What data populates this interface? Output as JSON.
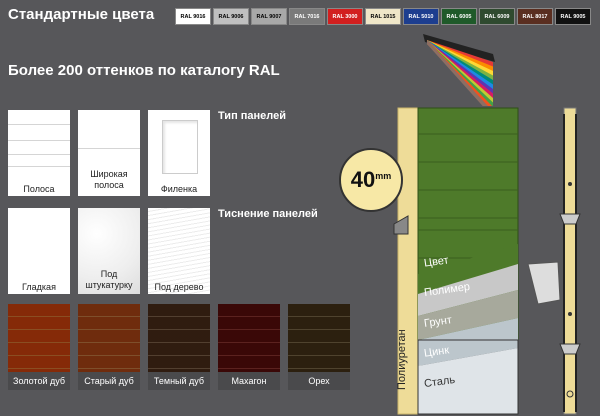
{
  "header": {
    "title": "Стандартные цвета",
    "subtitle": "Более 200 оттенков по каталогу RAL"
  },
  "swatches": [
    {
      "label": "RAL 9016",
      "color": "#ffffff",
      "text": "#000000"
    },
    {
      "label": "RAL 9006",
      "color": "#c0c0c0",
      "text": "#000000"
    },
    {
      "label": "RAL 9007",
      "color": "#a8a8a8",
      "text": "#000000"
    },
    {
      "label": "RAL 7016",
      "color": "#7a7a7a",
      "text": "#ffffff"
    },
    {
      "label": "RAL 3000",
      "color": "#d21f1f",
      "text": "#ffffff"
    },
    {
      "label": "RAL 1015",
      "color": "#efe6c8",
      "text": "#000000"
    },
    {
      "label": "RAL 5010",
      "color": "#1d3e8f",
      "text": "#ffffff"
    },
    {
      "label": "RAL 6005",
      "color": "#1f5a2a",
      "text": "#ffffff"
    },
    {
      "label": "RAL 6009",
      "color": "#2f4a2f",
      "text": "#ffffff"
    },
    {
      "label": "RAL 8017",
      "color": "#5a2e20",
      "text": "#ffffff"
    },
    {
      "label": "RAL 9005",
      "color": "#111111",
      "text": "#ffffff"
    }
  ],
  "panel_types": {
    "heading": "Тип панелей",
    "items": [
      {
        "label": "Полоса"
      },
      {
        "label": "Широкая полоса"
      },
      {
        "label": "Филенка"
      }
    ]
  },
  "embossing": {
    "heading": "Тиснение панелей",
    "items": [
      {
        "label": "Гладкая"
      },
      {
        "label": "Под штукатурку"
      },
      {
        "label": "Под дерево"
      }
    ]
  },
  "wood_finishes": [
    {
      "label": "Золотой дуб",
      "color": "#b8682e"
    },
    {
      "label": "Старый дуб",
      "color": "#a86a3a"
    },
    {
      "label": "Темный дуб",
      "color": "#6e5440"
    },
    {
      "label": "Махагон",
      "color": "#7a2e2a"
    },
    {
      "label": "Орех",
      "color": "#6a5a3e"
    }
  ],
  "cross_section": {
    "thickness_value": "40",
    "thickness_unit": "mm",
    "insulation_label": "Полиуретан",
    "layers": [
      {
        "label": "Цвет"
      },
      {
        "label": "Полимер"
      },
      {
        "label": "Грунт"
      },
      {
        "label": "Цинк"
      },
      {
        "label": "Сталь"
      }
    ],
    "colors": {
      "panel_green": "#4e7a2a",
      "foam": "#eedc98",
      "polymer": "#c8c8c8",
      "primer": "#a7a99c",
      "zinc": "#bcc6cc",
      "steel": "#dfe4e8"
    }
  }
}
